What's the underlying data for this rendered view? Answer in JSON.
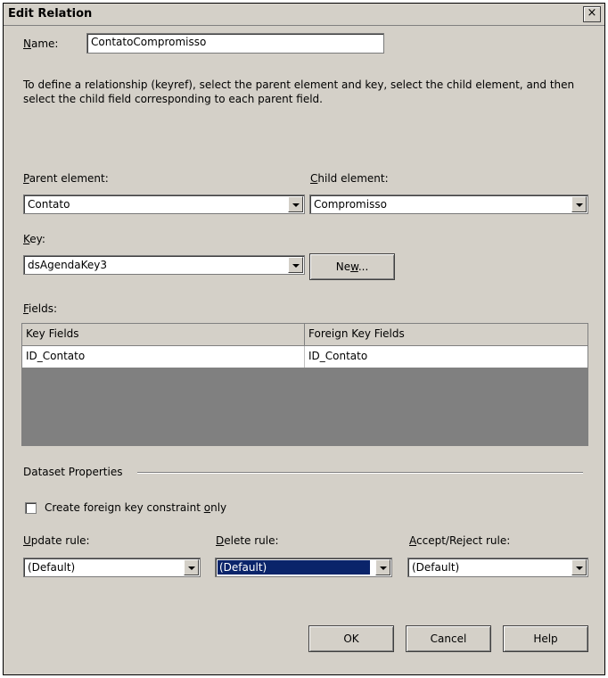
{
  "window": {
    "title": "Edit Relation",
    "close_glyph": "×"
  },
  "name": {
    "label_u": "N",
    "label_rest": "ame:",
    "value": "ContatoCompromisso"
  },
  "description": "To define a relationship (keyref), select the parent element and key, select the child element, and then select the child field corresponding to each parent field.",
  "parent": {
    "label_u": "P",
    "label_rest": "arent element:",
    "value": "Contato"
  },
  "child": {
    "label_u": "C",
    "label_rest": "hild element:",
    "value": "Compromisso"
  },
  "key": {
    "label_u": "K",
    "label_rest": "ey:",
    "value": "dsAgendaKey3",
    "new_pre": "Ne",
    "new_u": "w",
    "new_post": "..."
  },
  "fields": {
    "label_u": "F",
    "label_rest": "ields:",
    "headers": [
      "Key Fields",
      "Foreign Key Fields"
    ],
    "rows": [
      [
        "ID_Contato",
        "ID_Contato"
      ]
    ]
  },
  "dataset": {
    "group_label": "Dataset Properties",
    "checkbox_pre": "Create foreign key constraint ",
    "checkbox_u": "o",
    "checkbox_post": "nly",
    "checked": false
  },
  "rules": {
    "update": {
      "label_u": "U",
      "label_rest": "pdate rule:",
      "value": "(Default)"
    },
    "delete": {
      "label_u": "D",
      "label_rest": "elete rule:",
      "value": "(Default)"
    },
    "accept": {
      "label_u": "A",
      "label_rest": "ccept/Reject rule:",
      "value": "(Default)"
    }
  },
  "buttons": {
    "ok": "OK",
    "cancel": "Cancel",
    "help": "Help"
  },
  "colors": {
    "dialog_bg": "#d4d0c8",
    "selection": "#0a246a",
    "grid_empty": "#808080"
  }
}
